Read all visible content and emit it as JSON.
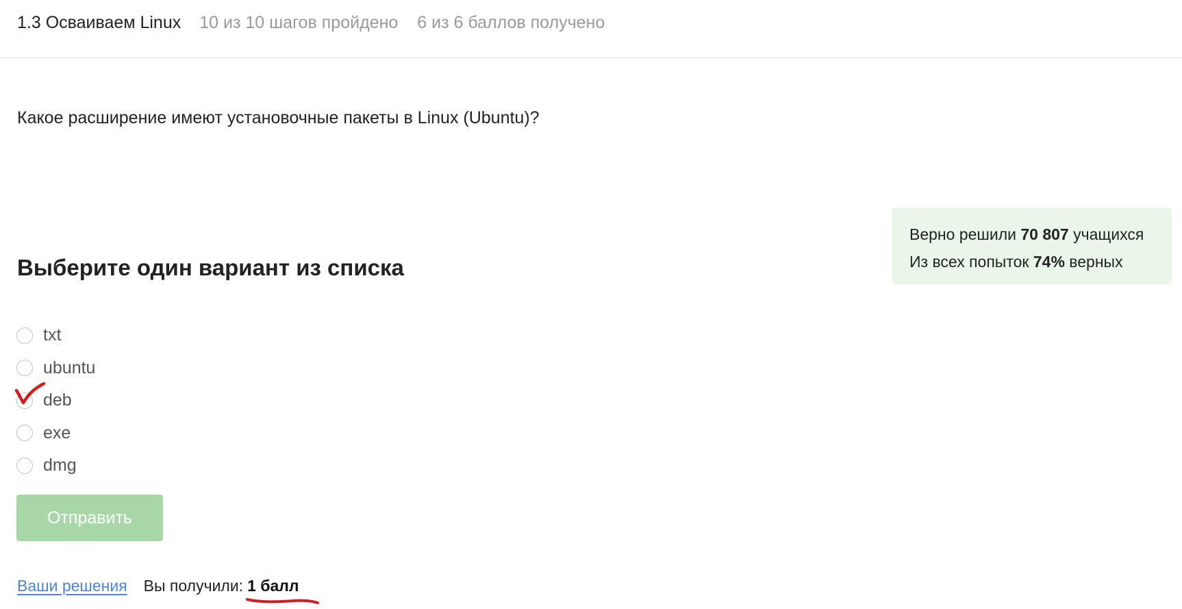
{
  "header": {
    "lesson_title": "1.3 Осваиваем Linux",
    "steps_progress": "10 из 10 шагов пройдено",
    "score_progress": "6 из 6 баллов  получено"
  },
  "question": {
    "text": "Какое расширение имеют установочные пакеты в Linux (Ubuntu)?"
  },
  "stats": {
    "solved_prefix": "Верно решили",
    "solved_count": "70 807",
    "solved_suffix": "учащихся",
    "attempts_prefix": "Из всех попыток",
    "attempts_percent": "74%",
    "attempts_suffix": "верных"
  },
  "quiz": {
    "heading": "Выберите один вариант из списка",
    "options": [
      {
        "label": "txt",
        "checked": false
      },
      {
        "label": "ubuntu",
        "checked": false
      },
      {
        "label": "deb",
        "checked": true
      },
      {
        "label": "exe",
        "checked": false
      },
      {
        "label": "dmg",
        "checked": false
      }
    ],
    "submit_label": "Отправить"
  },
  "footer": {
    "solutions_link": "Ваши решения",
    "result_label": "Вы получили:",
    "result_value": "1 балл"
  },
  "colors": {
    "accent_green": "#a8d8a8",
    "stats_background": "#e9f6e9",
    "link_blue": "#4a86d8",
    "annotation_red": "#d41c1c"
  }
}
